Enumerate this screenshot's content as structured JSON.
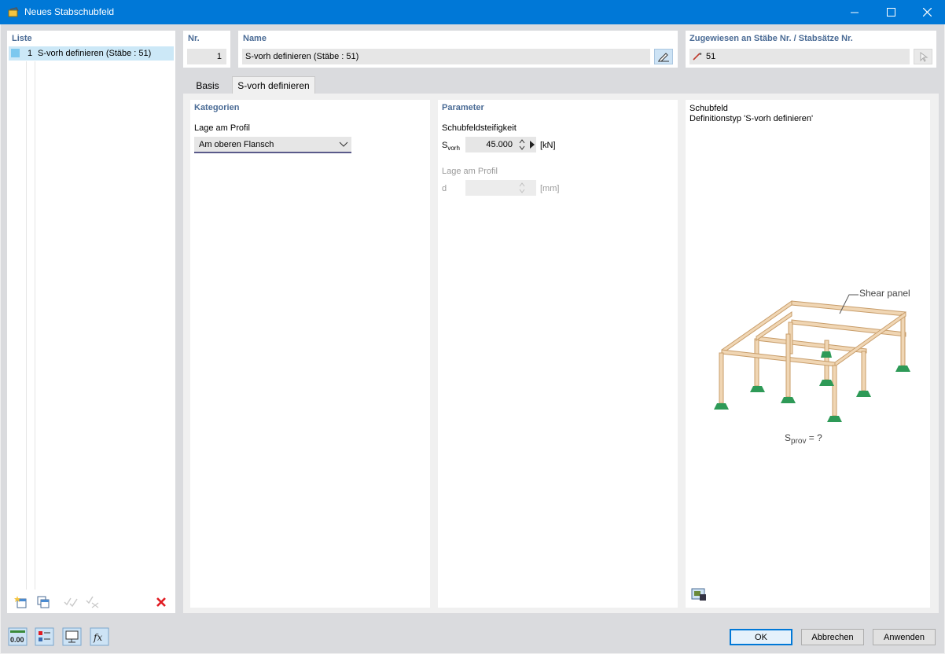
{
  "window": {
    "title": "Neues Stabschubfeld"
  },
  "list": {
    "header": "Liste",
    "items": [
      {
        "number": "1",
        "label": "S-vorh definieren (Stäbe : 51)"
      }
    ]
  },
  "nr": {
    "label": "Nr.",
    "value": "1"
  },
  "name": {
    "label": "Name",
    "value": "S-vorh definieren (Stäbe : 51)"
  },
  "assigned": {
    "label": "Zugewiesen an Stäbe Nr. / Stabsätze Nr.",
    "value": "51"
  },
  "tabs": [
    {
      "label": "Basis"
    },
    {
      "label": "S-vorh definieren"
    }
  ],
  "categories": {
    "header": "Kategorien",
    "position_label": "Lage am Profil",
    "position_value": "Am oberen Flansch"
  },
  "parameters": {
    "header": "Parameter",
    "stiffness_label": "Schubfeldsteifigkeit",
    "svorh_symbol": "S",
    "svorh_sub": "vorh",
    "svorh_value": "45.000",
    "svorh_unit": "[kN]",
    "position_label": "Lage am Profil",
    "d_label": "d",
    "d_unit": "[mm]"
  },
  "info": {
    "title": "Schubfeld",
    "subtitle": "Definitionstyp 'S-vorh definieren'",
    "figure_label": "Shear panel",
    "formula_symbol": "S",
    "formula_sub": "prov",
    "formula_rest": " = ?"
  },
  "buttons": {
    "ok": "OK",
    "cancel": "Abbrechen",
    "apply": "Anwenden"
  },
  "icons": {
    "units": "0.00",
    "formula": "fx"
  },
  "colors": {
    "accent": "#0078d7",
    "label": "#4a6b95",
    "support": "#2e9a57",
    "beam": "#f0d6b4"
  }
}
